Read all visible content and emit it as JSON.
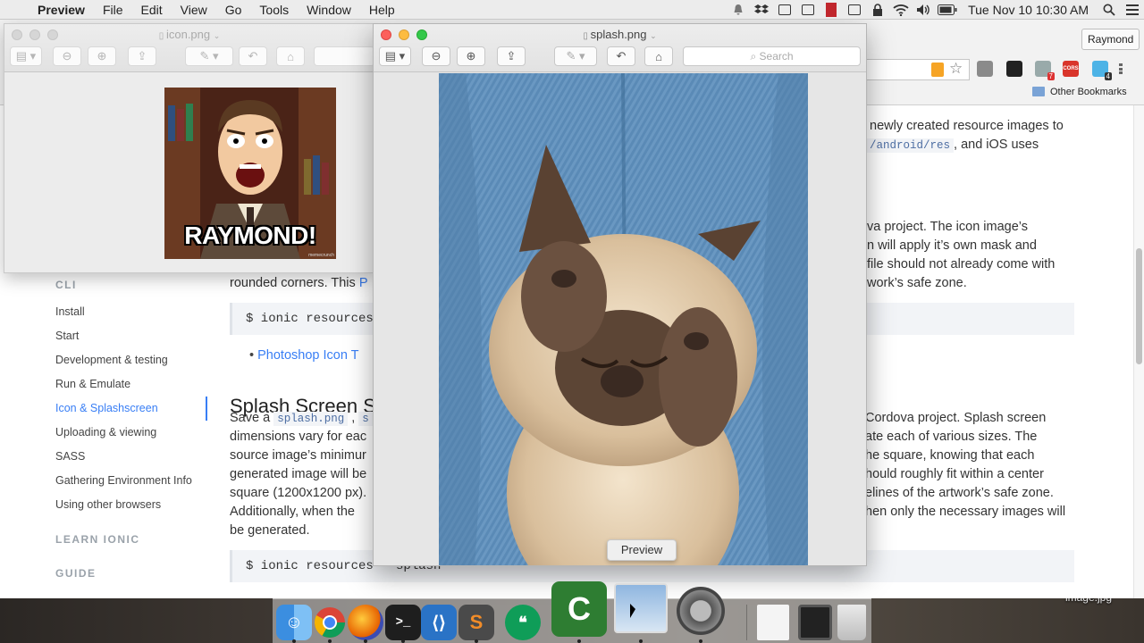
{
  "menubar": {
    "apple": "",
    "app_name": "Preview",
    "items": [
      "File",
      "Edit",
      "View",
      "Go",
      "Tools",
      "Window",
      "Help"
    ],
    "clock": "Tue Nov 10  10:30 AM"
  },
  "browser": {
    "profile": "Raymond",
    "bookmarks_folder": "Other Bookmarks",
    "extension_badges": {
      "cors": "CORS",
      "count_a": "7",
      "count_b": "4"
    },
    "sidebar": {
      "cli_heading": "CLI",
      "items": [
        "Install",
        "Start",
        "Development & testing",
        "Run & Emulate",
        "Icon & Splashscreen",
        "Uploading & viewing",
        "SASS",
        "Gathering Environment Info",
        "Using other browsers"
      ],
      "active_index": 4,
      "learn_heading": "LEARN IONIC",
      "guide_heading": "GUIDE"
    },
    "doc": {
      "p1_line1": "newly created resource images to",
      "p1_code": "/android/res",
      "p1_line2_end": ", and iOS uses",
      "p2_line1": "va project. The icon image’s",
      "p2_line2": "n will apply it’s own mask and",
      "p2_line3": "file should not already come with",
      "p2_line4_start": "rounded corners. This",
      "p2_line4_link": "P",
      "p2_line4_end": "work’s safe zone.",
      "code1": "$ ionic resources",
      "bullet_link": "Photoshop Icon T",
      "h2": "Splash Screen S",
      "s_line1_start": "Save a",
      "s_code1": "splash.png",
      "s_comma": ",",
      "s_code2": "s",
      "s_line1_end": "Cordova project. Splash screen",
      "s_line2a": "dimensions vary for eac",
      "s_line2b": "ate each of various sizes. The",
      "s_line3a": "source image’s minimur",
      "s_line3b": "he square, knowing that each",
      "s_line4a": "generated image will be",
      "s_line4b": "hould roughly fit within a center",
      "s_line5a": "square (1200x1200 px).",
      "s_line5b": "elines of the artwork’s safe zone.",
      "s_line6a": "Additionally, when the",
      "s_line6b": "hen only the necessary images will",
      "s_line7": "be generated.",
      "code2": "$ ionic resources --splash"
    }
  },
  "icon_window": {
    "title": "icon.png",
    "meme_caption": "RAYMOND!",
    "watermark": "memecrunch"
  },
  "splash_window": {
    "title": "splash.png",
    "search_placeholder": "Search"
  },
  "dock": {
    "tooltip": "Preview",
    "apps": [
      "Finder",
      "Chrome",
      "Firefox",
      "Terminal",
      "Visual Studio Code",
      "Sublime Text",
      "Hangouts",
      "Camtasia",
      "Preview",
      "System Preferences",
      "Document",
      "Camtasia Recorder",
      "Trash"
    ]
  },
  "desktop": {
    "file_label": "image.jpg"
  }
}
